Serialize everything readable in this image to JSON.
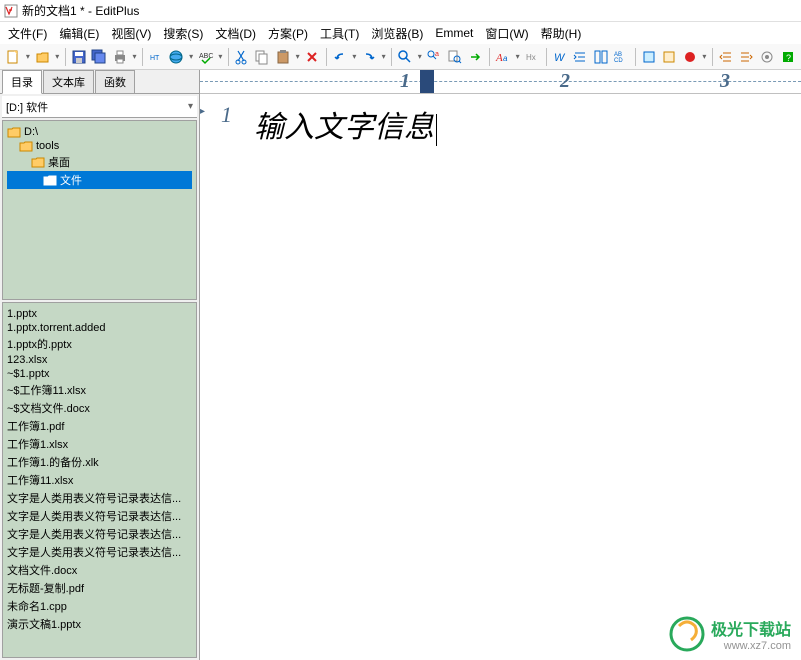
{
  "window": {
    "title": "新的文档1 * - EditPlus"
  },
  "menu": {
    "file": "文件(F)",
    "edit": "编辑(E)",
    "view": "视图(V)",
    "search": "搜索(S)",
    "document": "文档(D)",
    "project": "方案(P)",
    "tools": "工具(T)",
    "browser": "浏览器(B)",
    "emmet": "Emmet",
    "window": "窗口(W)",
    "help": "帮助(H)"
  },
  "sidebar": {
    "tabs": {
      "directory": "目录",
      "textlib": "文本库",
      "functions": "函数"
    },
    "drive": "[D:] 软件",
    "folders": [
      {
        "name": "D:\\",
        "level": 0
      },
      {
        "name": "tools",
        "level": 1
      },
      {
        "name": "桌面",
        "level": 2
      },
      {
        "name": "文件",
        "level": 3,
        "selected": true
      }
    ],
    "files": [
      "1.pptx",
      "1.pptx.torrent.added",
      "1.pptx的.pptx",
      "123.xlsx",
      "~$1.pptx",
      "~$工作簿11.xlsx",
      "~$文档文件.docx",
      "工作簿1.pdf",
      "工作簿1.xlsx",
      "工作簿1.的备份.xlk",
      "工作簿11.xlsx",
      "文字是人类用表义符号记录表达信...",
      "文字是人类用表义符号记录表达信...",
      "文字是人类用表义符号记录表达信...",
      "文字是人类用表义符号记录表达信...",
      "文档文件.docx",
      "无标题-复制.pdf",
      "未命名1.cpp",
      "演示文稿1.pptx"
    ]
  },
  "ruler": {
    "marks": [
      "1",
      "2",
      "3"
    ]
  },
  "editor": {
    "line": "1",
    "text": "输入文字信息"
  },
  "watermark": {
    "cn": "极光下载站",
    "url": "www.xz7.com"
  }
}
